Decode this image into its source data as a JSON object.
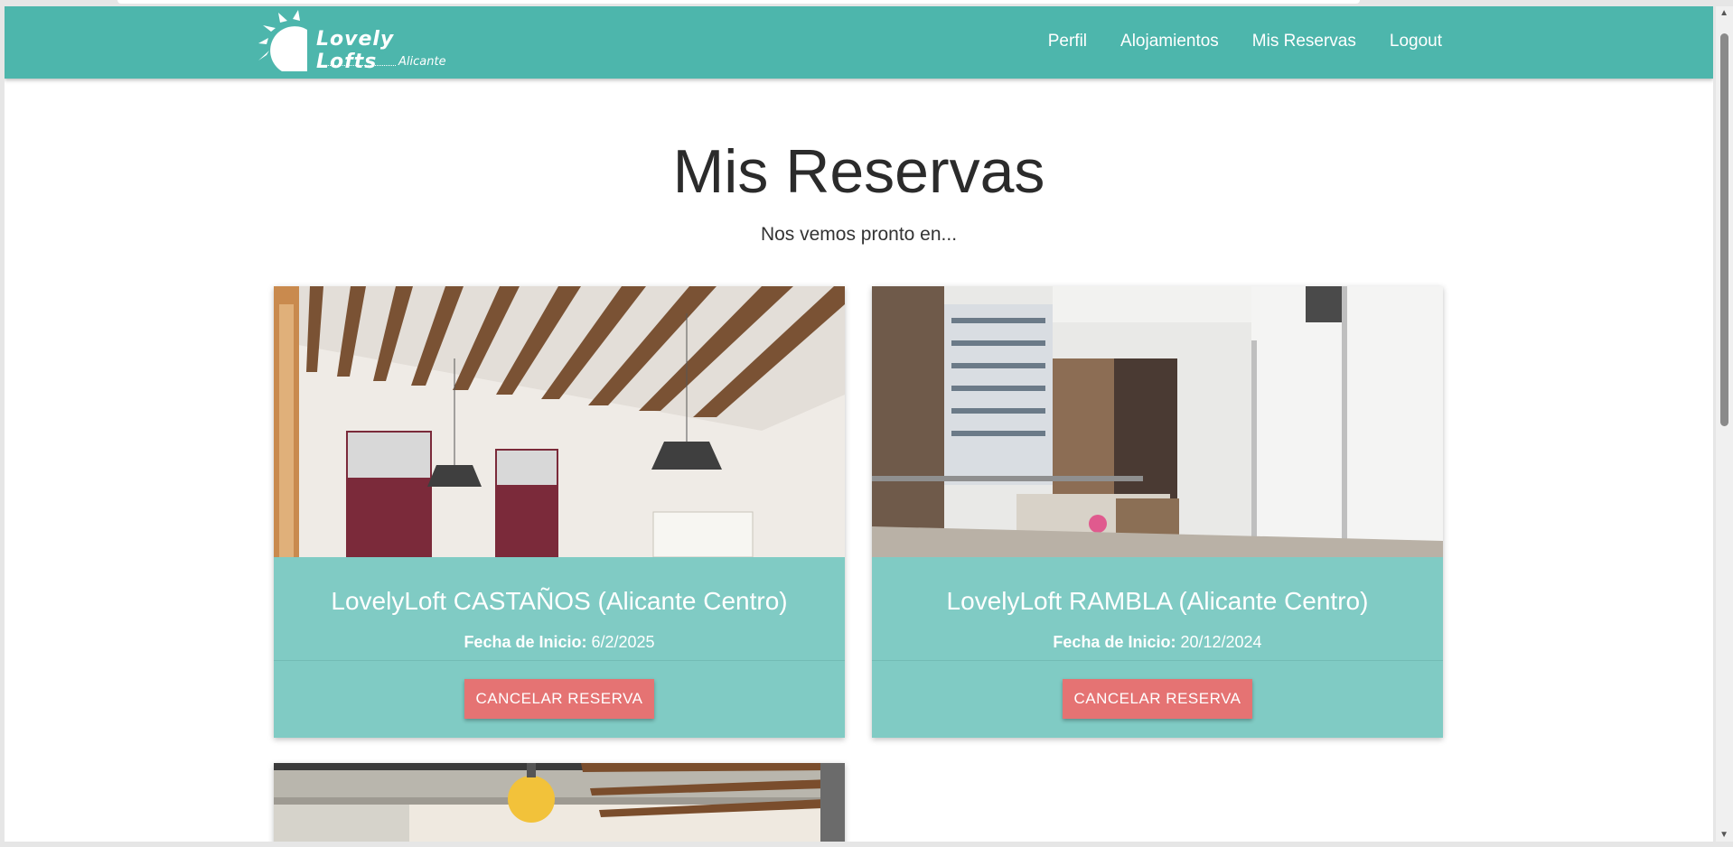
{
  "brand": {
    "name": "Lovely Lofts",
    "city": "Alicante"
  },
  "nav": {
    "links": [
      "Perfil",
      "Alojamientos",
      "Mis Reservas",
      "Logout"
    ]
  },
  "page": {
    "title": "Mis Reservas",
    "subtitle": "Nos vemos pronto en..."
  },
  "reservations": [
    {
      "name": "LovelyLoft CASTAÑOS (Alicante Centro)",
      "date_label": "Fecha de Inicio:",
      "date": "6/2/2025",
      "button": "CANCELAR RESERVA"
    },
    {
      "name": "LovelyLoft RAMBLA (Alicante Centro)",
      "date_label": "Fecha de Inicio:",
      "date": "20/12/2024",
      "button": "CANCELAR RESERVA"
    }
  ],
  "colors": {
    "navbar": "#4db6ac",
    "card": "#80cbc4",
    "button": "#e57373"
  }
}
